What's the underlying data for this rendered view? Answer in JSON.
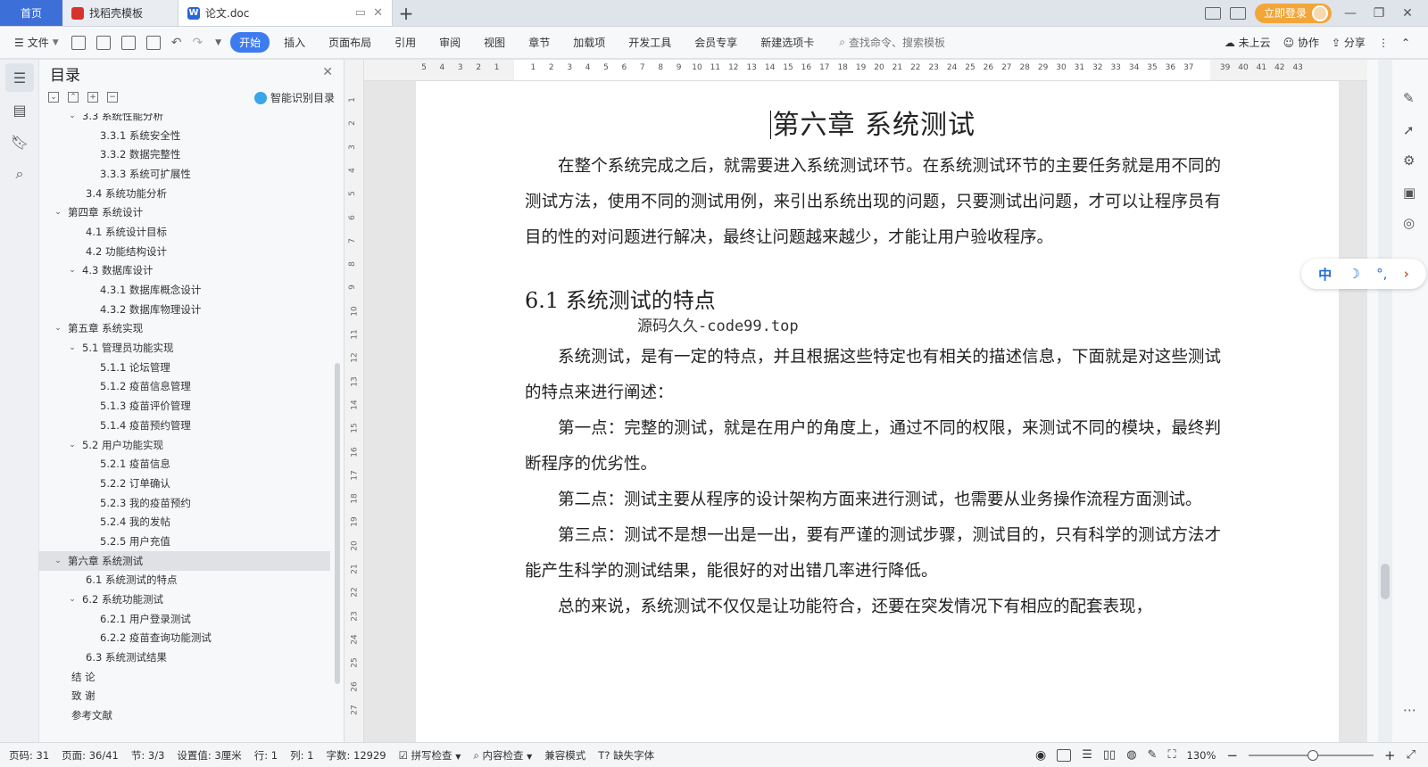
{
  "tabs": {
    "home": "首页",
    "items": [
      {
        "label": "找稻壳模板",
        "active": false
      },
      {
        "label": "论文.doc",
        "active": true
      }
    ],
    "add": "+",
    "login": "立即登录"
  },
  "toolbar": {
    "file": "文件",
    "ribbon": [
      "开始",
      "插入",
      "页面布局",
      "引用",
      "审阅",
      "视图",
      "章节",
      "加载项",
      "开发工具",
      "会员专享",
      "新建选项卡"
    ],
    "search_placeholder": "查找命令、搜索模板",
    "cloud": "未上云",
    "collab": "协作",
    "share": "分享"
  },
  "toc": {
    "title": "目录",
    "smart": "智能识别目录",
    "items": [
      {
        "text": "3.3 系统性能分析",
        "level": 2,
        "chev": true
      },
      {
        "text": "3.3.1 系统安全性",
        "level": 3
      },
      {
        "text": "3.3.2 数据完整性",
        "level": 3
      },
      {
        "text": "3.3.3 系统可扩展性",
        "level": 3
      },
      {
        "text": "3.4 系统功能分析",
        "level": 2
      },
      {
        "text": "第四章 系统设计",
        "level": 1,
        "chev": true
      },
      {
        "text": "4.1 系统设计目标",
        "level": 2
      },
      {
        "text": "4.2 功能结构设计",
        "level": 2
      },
      {
        "text": "4.3 数据库设计",
        "level": 2,
        "chev": true
      },
      {
        "text": "4.3.1 数据库概念设计",
        "level": 3
      },
      {
        "text": "4.3.2 数据库物理设计",
        "level": 3
      },
      {
        "text": "第五章 系统实现",
        "level": 1,
        "chev": true
      },
      {
        "text": "5.1 管理员功能实现",
        "level": 2,
        "chev": true
      },
      {
        "text": "5.1.1 论坛管理",
        "level": 3
      },
      {
        "text": "5.1.2 疫苗信息管理",
        "level": 3
      },
      {
        "text": "5.1.3 疫苗评价管理",
        "level": 3
      },
      {
        "text": "5.1.4 疫苗预约管理",
        "level": 3
      },
      {
        "text": "5.2 用户功能实现",
        "level": 2,
        "chev": true
      },
      {
        "text": "5.2.1 疫苗信息",
        "level": 3
      },
      {
        "text": "5.2.2 订单确认",
        "level": 3
      },
      {
        "text": "5.2.3 我的疫苗预约",
        "level": 3
      },
      {
        "text": "5.2.4 我的发帖",
        "level": 3
      },
      {
        "text": "5.2.5 用户充值",
        "level": 3
      },
      {
        "text": "第六章 系统测试",
        "level": 1,
        "chev": true,
        "selected": true
      },
      {
        "text": "6.1 系统测试的特点",
        "level": 2
      },
      {
        "text": "6.2 系统功能测试",
        "level": 2,
        "chev": true
      },
      {
        "text": "6.2.1 用户登录测试",
        "level": 3
      },
      {
        "text": "6.2.2 疫苗查询功能测试",
        "level": 3
      },
      {
        "text": "6.3 系统测试结果",
        "level": 2
      },
      {
        "text": "结 论",
        "level": 1
      },
      {
        "text": "致 谢",
        "level": 1
      },
      {
        "text": "参考文献",
        "level": 1
      }
    ]
  },
  "ruler": {
    "h_numbers": [
      "5",
      "4",
      "3",
      "2",
      "1",
      "",
      "1",
      "2",
      "3",
      "4",
      "5",
      "6",
      "7",
      "8",
      "9",
      "10",
      "11",
      "12",
      "13",
      "14",
      "15",
      "16",
      "17",
      "18",
      "19",
      "20",
      "21",
      "22",
      "23",
      "24",
      "25",
      "26",
      "27",
      "28",
      "29",
      "30",
      "31",
      "32",
      "33",
      "34",
      "35",
      "36",
      "37",
      "",
      "39",
      "40",
      "41",
      "42",
      "43"
    ],
    "v_numbers": [
      "1",
      "2",
      "3",
      "4",
      "5",
      "6",
      "7",
      "8",
      "9",
      "10",
      "11",
      "12",
      "13",
      "14",
      "15",
      "16",
      "17",
      "18",
      "19",
      "20",
      "21",
      "22",
      "23",
      "24",
      "25",
      "26",
      "27"
    ]
  },
  "doc": {
    "chapter_title": "第六章 系统测试",
    "intro": "在整个系统完成之后，就需要进入系统测试环节。在系统测试环节的主要任务就是用不同的测试方法，使用不同的测试用例，来引出系统出现的问题，只要测试出问题，才可以让程序员有目的性的对问题进行解决，最终让问题越来越少，才能让用户验收程序。",
    "section_title": "6.1 系统测试的特点",
    "watermark": "源码久久-code99.top",
    "p1": "系统测试，是有一定的特点，并且根据这些特定也有相关的描述信息，下面就是对这些测试的特点来进行阐述：",
    "p2": "第一点：完整的测试，就是在用户的角度上，通过不同的权限，来测试不同的模块，最终判断程序的优劣性。",
    "p3": "第二点：测试主要从程序的设计架构方面来进行测试，也需要从业务操作流程方面测试。",
    "p4": "第三点：测试不是想一出是一出，要有严谨的测试步骤，测试目的，只有科学的测试方法才能产生科学的测试结果，能很好的对出错几率进行降低。",
    "p5": "总的来说，系统测试不仅仅是让功能符合，还要在突发情况下有相应的配套表现，"
  },
  "ime": {
    "zh": "中",
    "moon": "☽",
    "punct": "°,",
    "arrow": "›"
  },
  "status": {
    "page_no": "页码: 31",
    "page": "页面: 36/41",
    "section": "节: 3/3",
    "setting": "设置值: 3厘米",
    "row": "行: 1",
    "col": "列: 1",
    "words": "字数: 12929",
    "spell": "拼写检查",
    "content_check": "内容检查",
    "compat": "兼容模式",
    "missing_font": "缺失字体",
    "zoom": "130%"
  }
}
